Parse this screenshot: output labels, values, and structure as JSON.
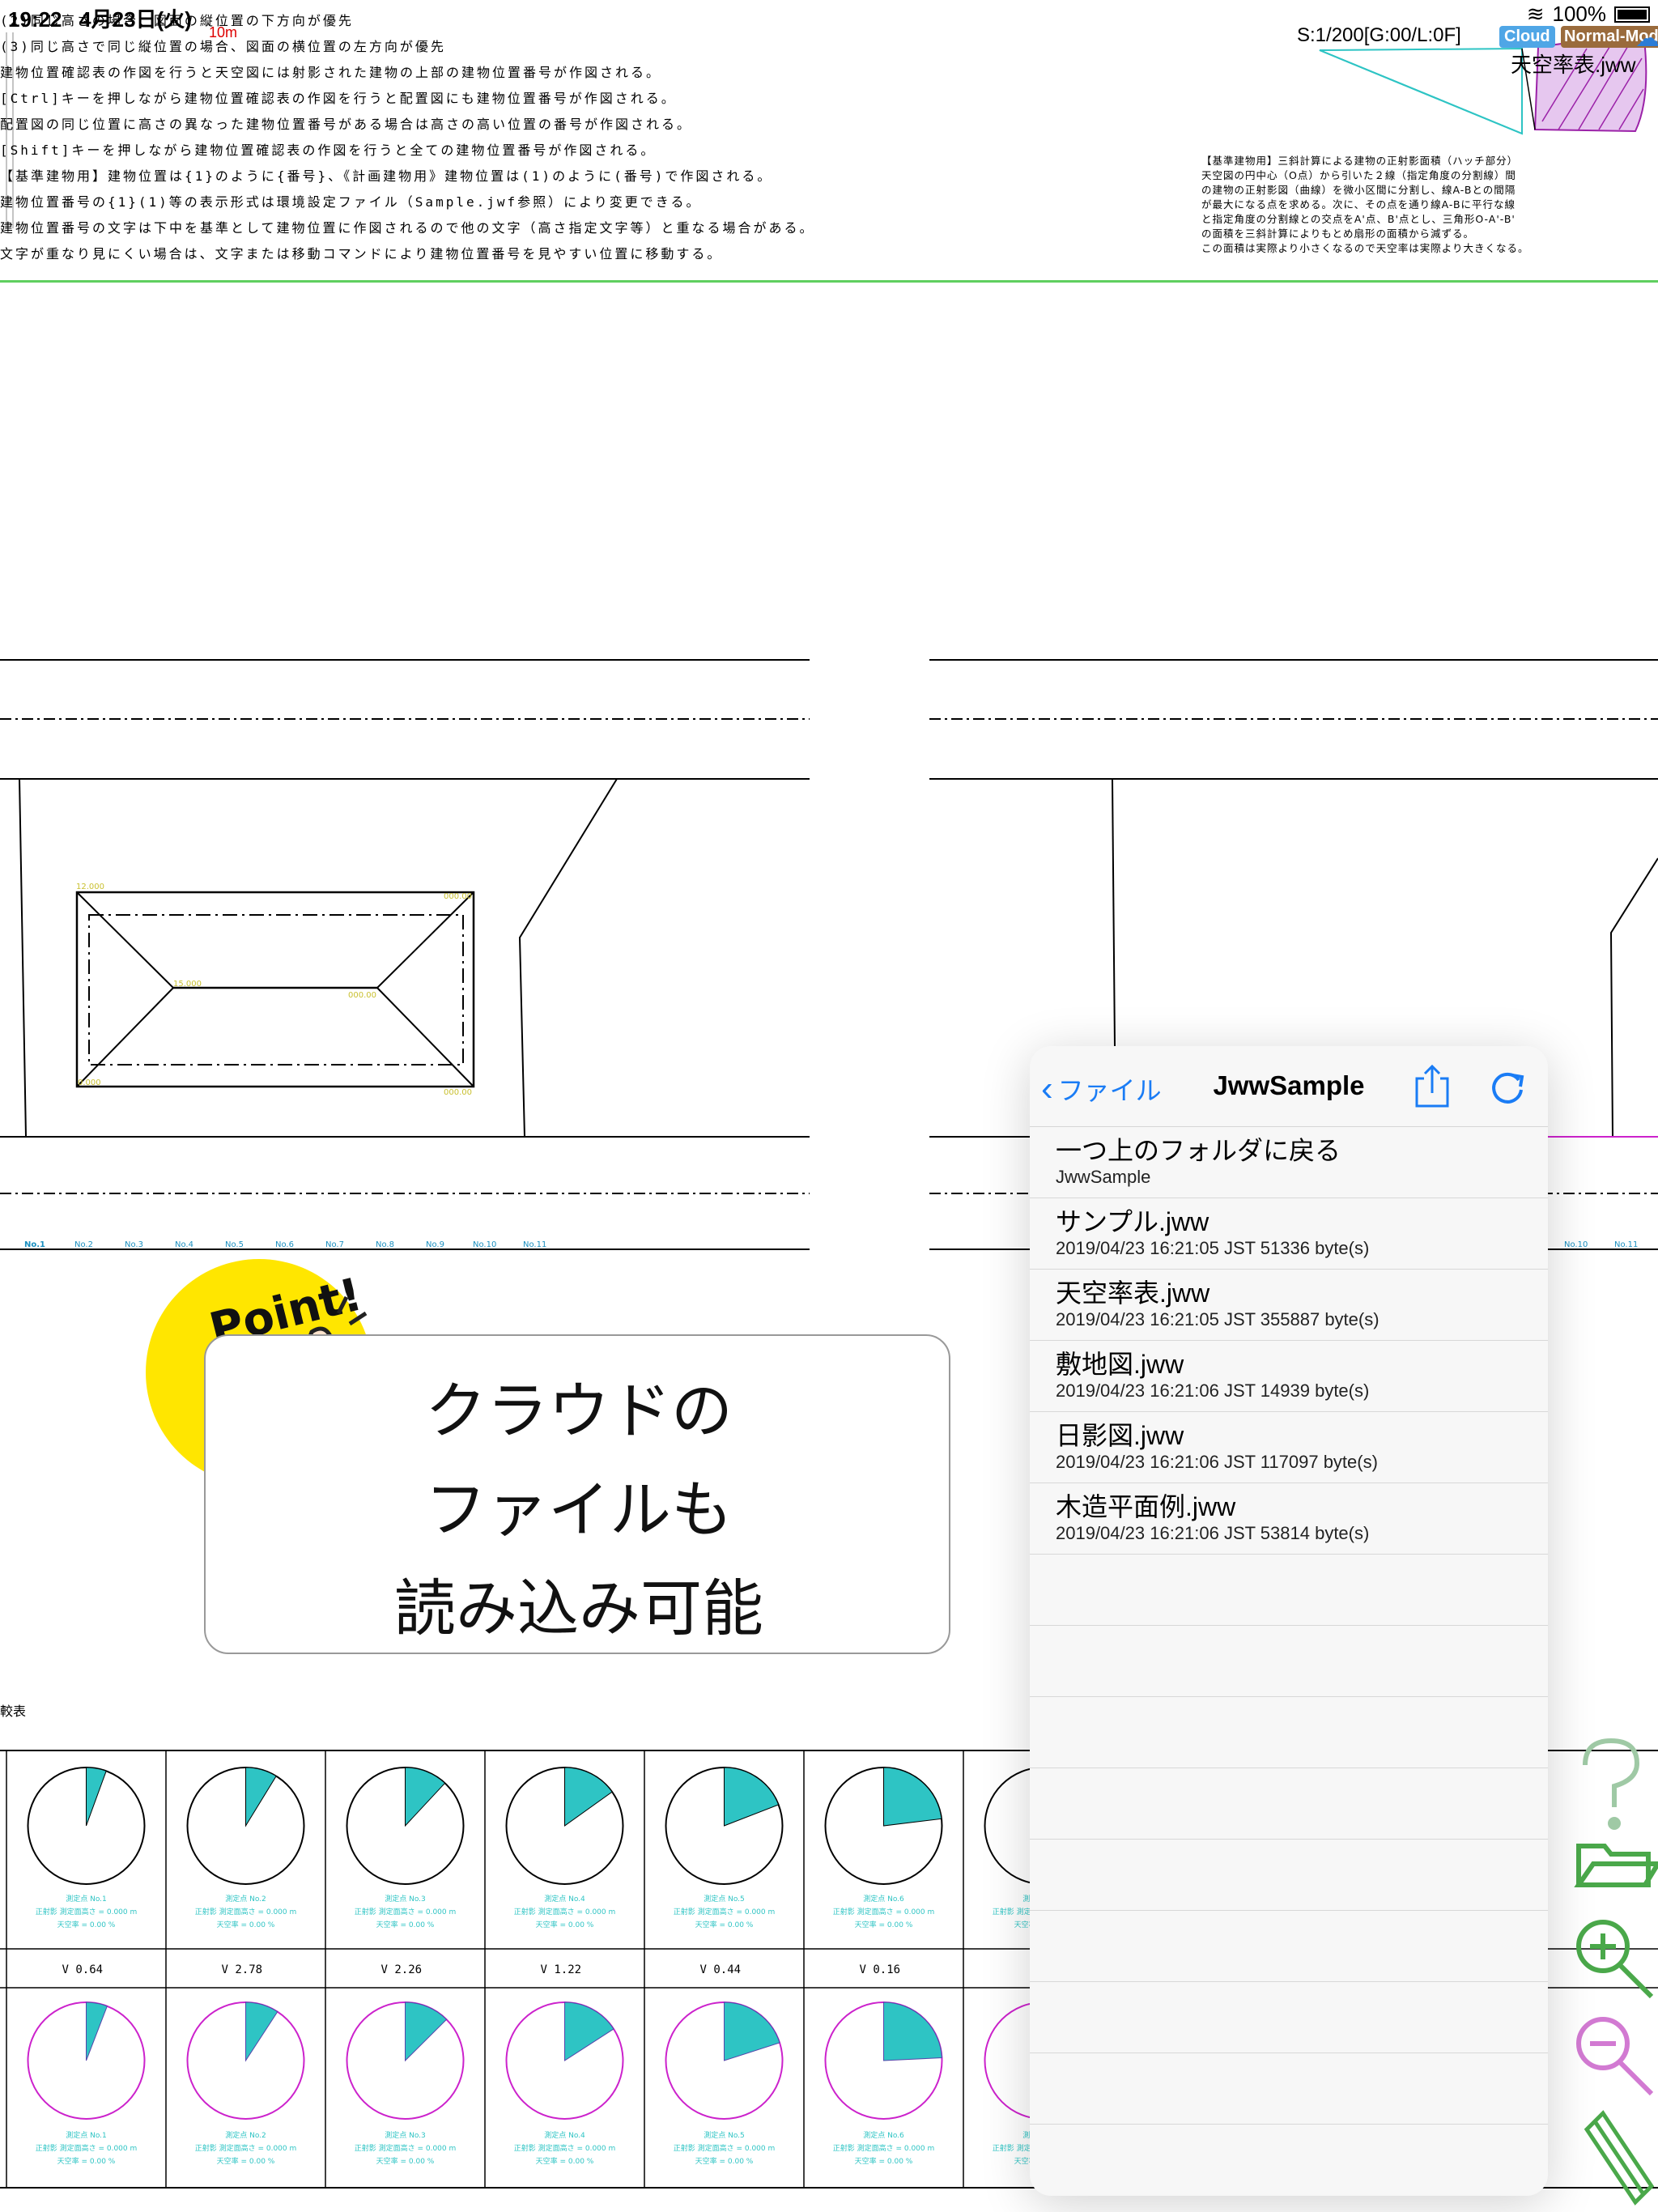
{
  "status_bar": {
    "time": "19:22",
    "date": "4月23日(火)",
    "battery": "100%"
  },
  "drawing_header": {
    "scale_mark": "10m",
    "scale_info": "S:1/200[G:00/L:0F]",
    "cloud_badge": "Cloud",
    "mode_badge": "Normal-Mode",
    "file_name": "天空率表.jww"
  },
  "notes_top": [
    "(2)同じ高さの場合、図面の縦位置の下方向が優先",
    "(3)同じ高さで同じ縦位置の場合、図面の横位置の左方向が優先",
    "建物位置確認表の作図を行うと天空図には射影された建物の上部の建物位置番号が作図される。",
    "[Ctrl]キーを押しながら建物位置確認表の作図を行うと配置図にも建物位置番号が作図される。",
    "配置図の同じ位置に高さの異なった建物位置番号がある場合は高さの高い位置の番号が作図される。",
    "[Shift]キーを押しながら建物位置確認表の作図を行うと全ての建物位置番号が作図される。",
    "【基準建物用】建物位置は{1}のように{番号}、《計画建物用》建物位置は(1)のように(番号)で作図される。",
    "建物位置番号の{1}(1)等の表示形式は環境設定ファイル（Sample.jwf参照）により変更できる。",
    "建物位置番号の文字は下中を基準として建物位置に作図されるので他の文字（高さ指定文字等）と重なる場合がある。",
    "文字が重なり見にくい場合は、文字または移動コマンドにより建物位置番号を見やすい位置に移動する。"
  ],
  "notes_right": [
    "【基準建物用】三斜計算による建物の正射影面積（ハッチ部分）",
    "天空図の円中心（O点）から引いた２線（指定角度の分割線）間",
    "の建物の正射影図（曲線）を微小区間に分割し、線A-Bとの間隔",
    "が最大になる点を求める。次に、その点を通り線A-Bに平行な線",
    "と指定角度の分割線との交点をA'点、B'点とし、三角形O-A'-B'",
    "の面積を三斜計算によりもとめ扇形の面積から減ずる。",
    "この面積は実際より小さくなるので天空率は実際より大きくなる。"
  ],
  "callout": {
    "lines": [
      "クラウドの",
      "ファイルも",
      "読み込み可能"
    ],
    "badge_text": "Point!"
  },
  "popover": {
    "back_label": "ファイル",
    "title": "JwwSample",
    "items": [
      {
        "title": "一つ上のフォルダに戻る",
        "sub": "JwwSample"
      },
      {
        "title": "サンプル.jww",
        "sub": "2019/04/23 16:21:05 JST 51336 byte(s)"
      },
      {
        "title": "天空率表.jww",
        "sub": "2019/04/23 16:21:05 JST 355887 byte(s)"
      },
      {
        "title": "敷地図.jww",
        "sub": "2019/04/23 16:21:06 JST 14939 byte(s)"
      },
      {
        "title": "日影図.jww",
        "sub": "2019/04/23 16:21:06 JST 117097 byte(s)"
      },
      {
        "title": "木造平面例.jww",
        "sub": "2019/04/23 16:21:06 JST 53814 byte(s)"
      }
    ]
  },
  "sky_table": {
    "label": "較表",
    "v_values": [
      "0.64",
      "2.78",
      "2.26",
      "1.22",
      "0.44",
      "0.16"
    ],
    "points": [
      "No.1",
      "No.2",
      "No.3",
      "No.4",
      "No.5",
      "No.6",
      "No.7",
      "No.8",
      "No.9",
      "No.10",
      "No.11"
    ]
  },
  "colors": {
    "accent": "#1a7cf5",
    "cyan": "#2ec4c4",
    "magenta": "#cc22cc",
    "green_rule": "#5fcf5f",
    "yellow": "#ffe600"
  },
  "icons": [
    "share-icon",
    "refresh-icon",
    "help-icon",
    "folder-open-icon",
    "zoom-in-icon",
    "zoom-out-icon",
    "pencil-icon",
    "cloud-icon",
    "battery-icon"
  ]
}
